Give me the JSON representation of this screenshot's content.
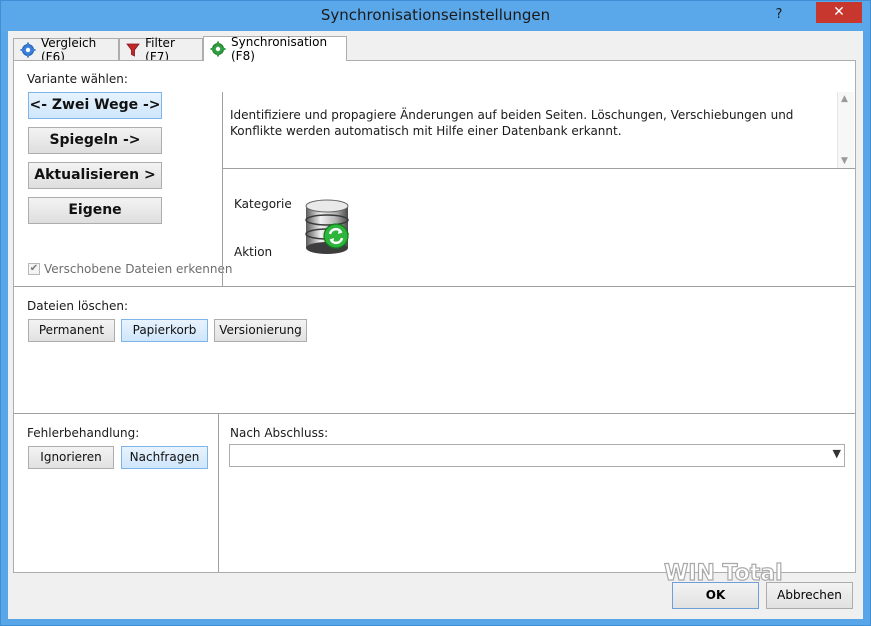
{
  "window": {
    "title": "Synchronisationseinstellungen",
    "help_glyph": "?",
    "close_glyph": "✕"
  },
  "tabs": [
    {
      "label": "Vergleich (F6)",
      "icon": "gear-blue-icon",
      "active": false
    },
    {
      "label": "Filter (F7)",
      "icon": "filter-icon",
      "active": false
    },
    {
      "label": "Synchronisation (F8)",
      "icon": "gear-green-icon",
      "active": true
    }
  ],
  "variant": {
    "heading": "Variante wählen:",
    "options": [
      {
        "label": "<- Zwei Wege ->",
        "selected": true
      },
      {
        "label": "Spiegeln ->",
        "selected": false
      },
      {
        "label": "Aktualisieren >",
        "selected": false
      },
      {
        "label": "Eigene",
        "selected": false
      }
    ],
    "detect_moved": {
      "label": "Verschobene Dateien erkennen",
      "checked": true,
      "enabled": false
    }
  },
  "description": "Identifiziere und propagiere Änderungen auf beiden Seiten. Löschungen, Verschiebungen und Konflikte werden automatisch mit Hilfe einer Datenbank erkannt.",
  "category": {
    "kategorie_label": "Kategorie",
    "aktion_label": "Aktion",
    "icon": "database-sync-icon"
  },
  "delete_files": {
    "heading": "Dateien löschen:",
    "options": [
      {
        "label": "Permanent",
        "selected": false
      },
      {
        "label": "Papierkorb",
        "selected": true
      },
      {
        "label": "Versionierung",
        "selected": false
      }
    ]
  },
  "error_handling": {
    "heading": "Fehlerbehandlung:",
    "options": [
      {
        "label": "Ignorieren",
        "selected": false
      },
      {
        "label": "Nachfragen",
        "selected": true
      }
    ]
  },
  "after_completion": {
    "heading": "Nach Abschluss:",
    "value": ""
  },
  "dialog_buttons": {
    "ok": "OK",
    "cancel": "Abbrechen"
  },
  "watermark": {
    "text": "WIN Total"
  },
  "colors": {
    "titlebar": "#5aa8ea",
    "close_button": "#c7372e",
    "selected_button": "#cfe6fc",
    "selected_border": "#7eb4ea"
  }
}
